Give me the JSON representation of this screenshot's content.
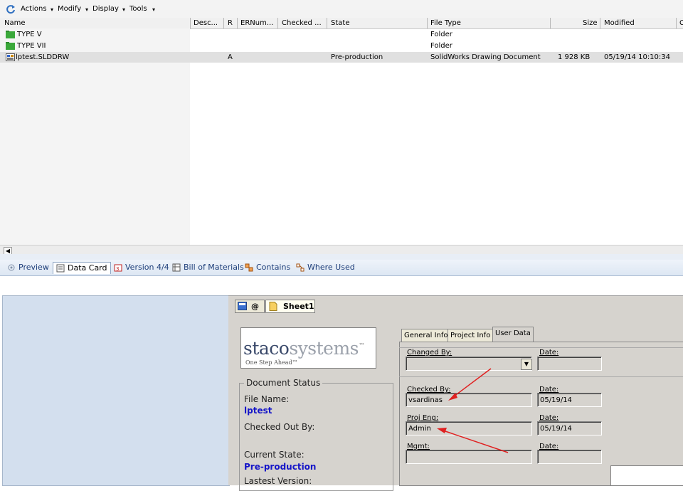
{
  "toolbar": {
    "menus": [
      "Actions",
      "Modify",
      "Display",
      "Tools"
    ]
  },
  "file_list": {
    "columns": [
      "Name",
      "Desc...",
      "R",
      "ERNum...",
      "Checked ...",
      "State",
      "File Type",
      "Size",
      "Modified",
      "C"
    ],
    "rows": [
      {
        "name": "TYPE V",
        "rev": "",
        "state": "",
        "file_type": "Folder",
        "size": "",
        "modified": "",
        "icon": "folder-icon"
      },
      {
        "name": "TYPE VII",
        "rev": "",
        "state": "",
        "file_type": "Folder",
        "size": "",
        "modified": "",
        "icon": "folder-icon"
      },
      {
        "name": "lptest.SLDDRW",
        "rev": "A",
        "state": "Pre-production",
        "file_type": "SolidWorks Drawing Document",
        "size": "1 928 KB",
        "modified": "05/19/14 10:10:34",
        "icon": "drawing-file-icon"
      }
    ]
  },
  "bottom_tabs": [
    "Preview",
    "Data Card",
    "Version 4/4",
    "Bill of Materials",
    "Contains",
    "Where Used"
  ],
  "card": {
    "sheet_tabs": [
      "@",
      "Sheet1"
    ],
    "logo": {
      "main": "staco",
      "accent": "systems",
      "tm": "™",
      "tagline": "One Step Ahead™"
    },
    "doc_status": {
      "legend": "Document Status",
      "file_name_label": "File Name:",
      "file_name_value": "lptest",
      "checked_out_label": "Checked Out By:",
      "current_state_label": "Current State:",
      "current_state_value": "Pre-production",
      "latest_version_label": "Lastest Version:"
    },
    "user_tabs": [
      "General Info",
      "Project Info",
      "User Data"
    ],
    "fields": {
      "changed_by_label": "Changed By:",
      "changed_by_value": "",
      "date_label": "Date:",
      "changed_date": "",
      "checked_by_label": "Checked By:",
      "checked_by_value": "vsardinas",
      "checked_date": "05/19/14",
      "proj_eng_label": "Proj Eng:",
      "proj_eng_value": "Admin",
      "proj_eng_date": "05/19/14",
      "mgmt_label": "Mgmt:",
      "mgmt_value": "",
      "mgmt_date": ""
    }
  },
  "colors": {
    "accent_blue": "#1515c8",
    "annotation_arrow": "#e02020",
    "folder_green": "#3aa83a"
  }
}
